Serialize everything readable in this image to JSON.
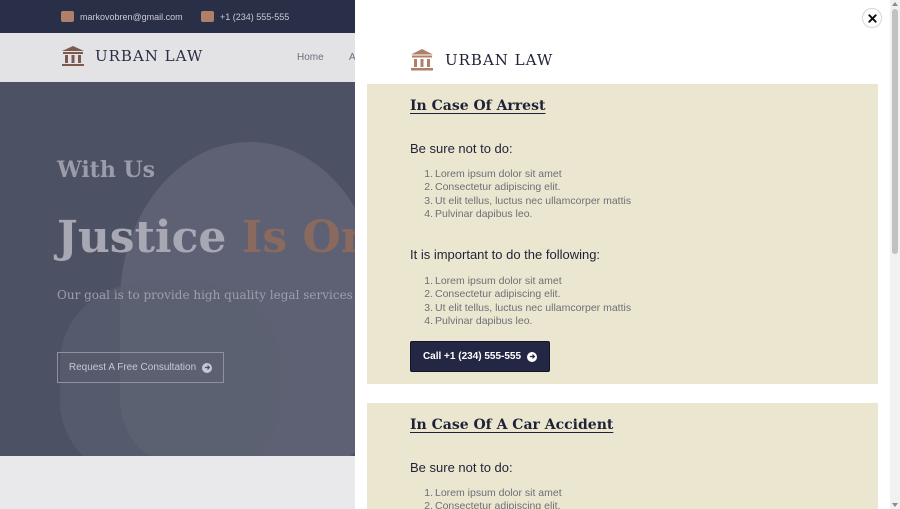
{
  "site": {
    "topbar": {
      "email": "markovobren@gmail.com",
      "phone": "+1 (234) 555-555"
    },
    "logo": "URBAN LAW",
    "nav": {
      "home": "Home",
      "about_partial": "A"
    },
    "hero": {
      "subtitle": "With Us",
      "title_part1": "Justice ",
      "title_part2": "Is On Y",
      "description": "Our goal is to provide high quality legal services using a",
      "cta": "Request A Free Consultation"
    }
  },
  "panel": {
    "logo": "URBAN LAW",
    "cards": [
      {
        "title": "In Case Of Arrest",
        "dont_heading": "Be sure not to do:",
        "dont_items": [
          "Lorem ipsum dolor sit amet",
          "Consectetur adipiscing elit.",
          "Ut elit tellus, luctus nec ullamcorper mattis",
          "Pulvinar dapibus leo."
        ],
        "do_heading": "It is important to do the following:",
        "do_items": [
          "Lorem ipsum dolor sit amet",
          "Consectetur adipiscing elit.",
          "Ut elit tellus, luctus nec ullamcorper mattis",
          "Pulvinar dapibus leo."
        ],
        "cta": "Call +1 (234) 555-555"
      },
      {
        "title": "In Case Of A Car Accident",
        "dont_heading": "Be sure not to do:",
        "dont_items": [
          "Lorem ipsum dolor sit amet",
          "Consectetur adipiscing elit."
        ]
      }
    ]
  },
  "colors": {
    "overlay": "#4c5164",
    "accent": "#b07f6a",
    "card_bg": "#ebe6d0",
    "button_bg": "#232744"
  },
  "icons": [
    "email-icon",
    "phone-icon",
    "courthouse-icon",
    "close-icon",
    "arrow-right-circle-icon"
  ]
}
